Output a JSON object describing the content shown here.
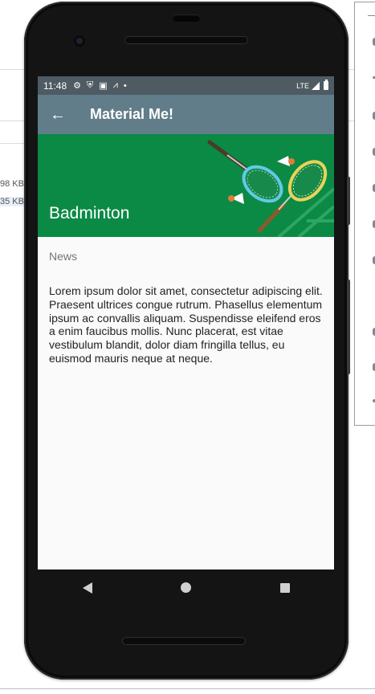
{
  "background": {
    "file_sizes": [
      "98 KB",
      "35 KB"
    ]
  },
  "status_bar": {
    "time": "11:48",
    "network": "LTE",
    "icons": [
      "settings-icon",
      "shield-icon",
      "sim-icon",
      "signal-alt-icon",
      "dot-icon",
      "signal-icon",
      "battery-icon"
    ]
  },
  "app_bar": {
    "title": "Material Me!",
    "back_icon": "arrow-back-icon"
  },
  "detail": {
    "sport_title": "Badminton",
    "subtitle": "News",
    "body": "Lorem ipsum dolor sit amet, consectetur adipiscing elit. Praesent ultrices congue rutrum. Phasellus elementum ipsum ac convallis aliquam. Suspendisse eleifend eros a enim faucibus mollis. Nunc placerat, est vitae vestibulum blandit, dolor diam fringilla tellus, eu euismod mauris neque at neque."
  },
  "colors": {
    "status_bar": "#4e5b62",
    "app_bar": "#617d8a",
    "banner": "#0b8a45",
    "screen_bg": "#fafafa",
    "phone_body": "#141414"
  },
  "nav_bar": {
    "icons": [
      "nav-back-icon",
      "nav-home-icon",
      "nav-recents-icon"
    ]
  }
}
